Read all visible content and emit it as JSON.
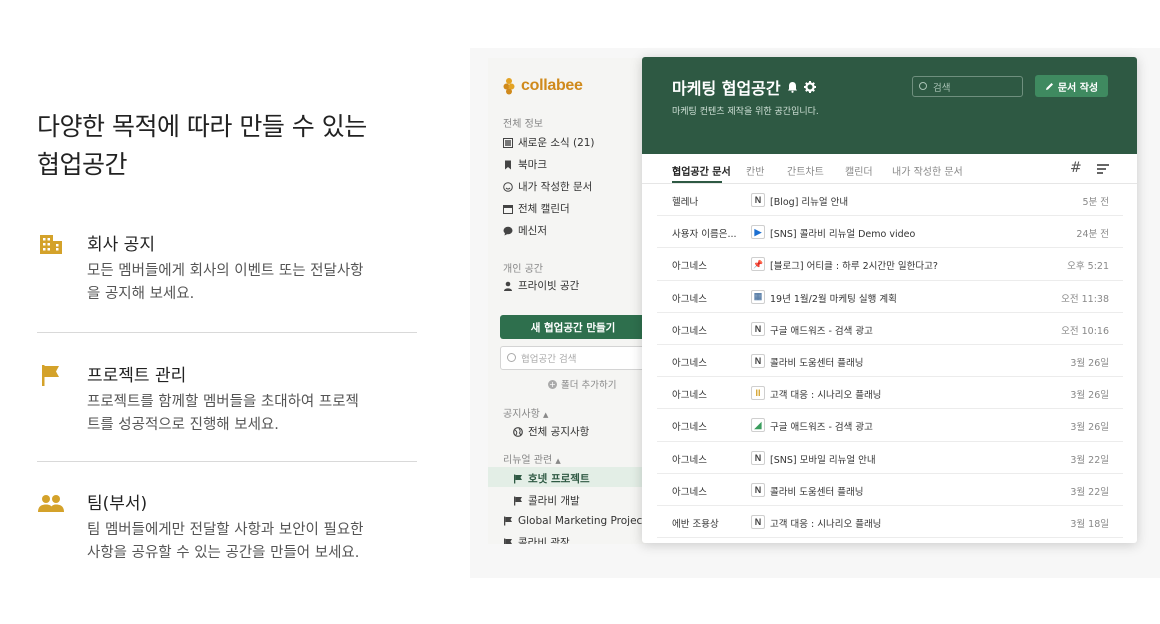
{
  "hero": {
    "title_line1": "다양한 목적에 따라 만들 수 있는",
    "title_line2": "협업공간"
  },
  "features": [
    {
      "icon": "building-icon",
      "title": "회사 공지",
      "desc_line1": "모든 멤버들에게 회사의 이벤트 또는 전달사항",
      "desc_line2": "을 공지해 보세요."
    },
    {
      "icon": "flag-icon",
      "title": "프로젝트 관리",
      "desc_line1": "프로젝트를 함께할 멤버들을 초대하여 프로젝",
      "desc_line2": "트를 성공적으로 진행해 보세요."
    },
    {
      "icon": "team-icon",
      "title": "팀(부서)",
      "desc_line1": "팀 멤버들에게만 전달할 사항과 보안이 필요한",
      "desc_line2": "사항을 공유할 수 있는 공간을 만들어 보세요."
    }
  ],
  "colors": {
    "accent_gold": "#d4a22a",
    "header_green": "#2e5943",
    "button_green": "#2e6f4d"
  },
  "sidebar": {
    "logo": "collabee",
    "section_all": "전체 정보",
    "items_all": [
      "새로운 소식 (21)",
      "북마크",
      "내가 작성한 문서",
      "전체 캘린더",
      "메신저"
    ],
    "section_personal": "개인 공간",
    "private_space": "프라이빗 공간",
    "new_workspace_button": "새 협업공간 만들기",
    "search_placeholder": "협업공간 검색",
    "add_folder": "폴더 추가하기",
    "section_notice": "공지사항",
    "notice_item": "전체 공지사항",
    "section_renewal": "리뉴얼 관련",
    "renewal_items": [
      "호넷 프로젝트",
      "콜라비 개발"
    ],
    "global_project": "Global Marketing Project...",
    "last_item": "콜라비 광장"
  },
  "main": {
    "title": "마케팅 협업공간",
    "subtitle": "마케팅 컨텐츠 제작을 위한 공간입니다.",
    "search_placeholder": "검색",
    "new_doc_button": "문서 작성",
    "tabs": [
      "협업공간 문서",
      "칸반",
      "간트차트",
      "캘린더",
      "내가 작성한 문서"
    ],
    "hash_symbol": "#",
    "rows": [
      {
        "author": "헬레나",
        "icon": "N",
        "title": "[Blog] 리뉴얼 안내",
        "time": "5분 전"
      },
      {
        "author": "사용자 이름은...",
        "icon": "▶",
        "title": "[SNS] 콜라비 리뉴얼 Demo video",
        "time": "24분 전"
      },
      {
        "author": "아그네스",
        "icon": "📌",
        "title": "[블로그] 어티클 : 하루 2시간만 일한다고?",
        "time": "오후 5:21"
      },
      {
        "author": "아그네스",
        "icon": "▦",
        "title": "19년 1월/2월 마케팅 실행 계획",
        "time": "오전 11:38"
      },
      {
        "author": "아그네스",
        "icon": "N",
        "title": "구글 애드워즈 - 검색 광고",
        "time": "오전 10:16"
      },
      {
        "author": "아그네스",
        "icon": "N",
        "title": "콜라비 도움센터 플래닝",
        "time": "3월 26일"
      },
      {
        "author": "아그네스",
        "icon": "II",
        "title": "고객 대응 : 시나리오 플래닝",
        "time": "3월 26일"
      },
      {
        "author": "아그네스",
        "icon": "◢",
        "title": "구글 애드워즈 - 검색 광고",
        "time": "3월 26일"
      },
      {
        "author": "아그네스",
        "icon": "N",
        "title": "[SNS] 모바일 리뉴얼 안내",
        "time": "3월 22일"
      },
      {
        "author": "아그네스",
        "icon": "N",
        "title": "콜라비 도움센터 플래닝",
        "time": "3월 22일"
      },
      {
        "author": "에반 조용상",
        "icon": "N",
        "title": "고객 대응 : 시나리오 플래닝",
        "time": "3월 18일"
      }
    ]
  }
}
